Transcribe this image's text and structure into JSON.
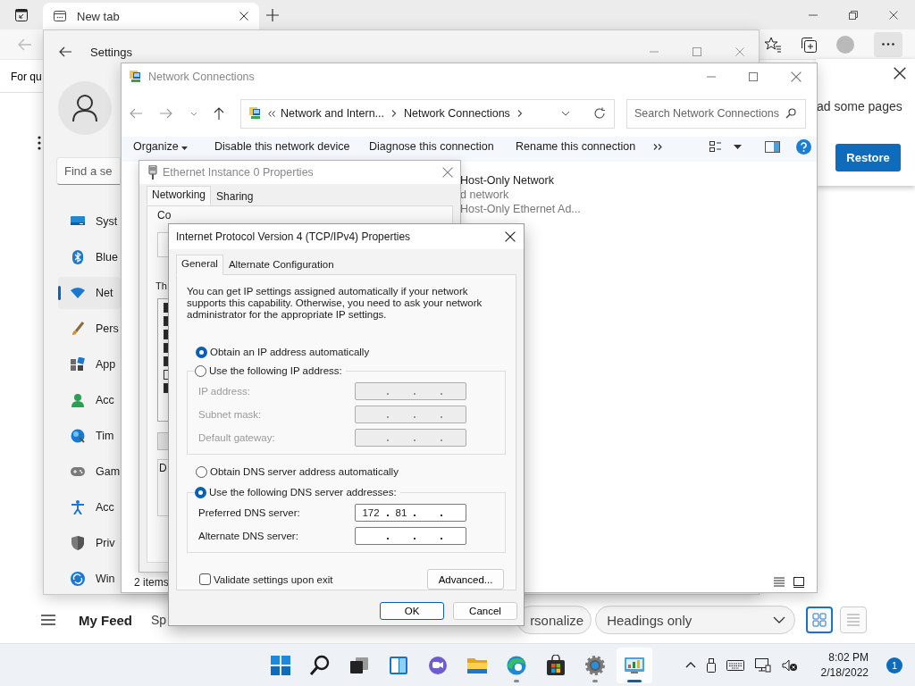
{
  "browser": {
    "tabs": [
      {
        "label": "New tab",
        "selected": true
      }
    ],
    "page_heading": "For qu",
    "restore_banner": {
      "text": "ad some pages",
      "button": "Restore"
    },
    "feed_bar": {
      "tabs": [
        {
          "label": "My Feed",
          "selected": true
        },
        {
          "label": "Sp",
          "selected": false
        }
      ],
      "personalize_button": "rsonalize",
      "view_dropdown": "Headings only",
      "layout_buttons": [
        {
          "selected": true
        },
        {
          "selected": false
        }
      ]
    }
  },
  "settings": {
    "title": "Settings",
    "search": {
      "placeholder": "Find a se"
    },
    "nav": [
      {
        "label": "Syst",
        "selected": false
      },
      {
        "label": "Blue",
        "selected": false
      },
      {
        "label": "Net",
        "selected": true
      },
      {
        "label": "Pers",
        "selected": false
      },
      {
        "label": "App",
        "selected": false
      },
      {
        "label": "Acc",
        "selected": false
      },
      {
        "label": "Tim",
        "selected": false
      },
      {
        "label": "Gam",
        "selected": false
      },
      {
        "label": "Acc",
        "selected": false
      },
      {
        "label": "Priv",
        "selected": false
      },
      {
        "label": "Win",
        "selected": false
      }
    ]
  },
  "network_connections": {
    "title": "Network Connections",
    "breadcrumb": [
      "Network and Intern...",
      "Network Connections"
    ],
    "search": {
      "placeholder": "Search Network Connections"
    },
    "toolbar": [
      "Organize",
      "Disable this network device",
      "Diagnose this connection",
      "Rename this connection"
    ],
    "connection": {
      "name": "Host-Only Network",
      "status": "d network",
      "device": "Host-Only Ethernet Ad..."
    },
    "status_bar": "2 items"
  },
  "ethernet_properties": {
    "title": "Ethernet Instance 0 Properties",
    "tabs": [
      {
        "label": "Networking",
        "selected": true
      },
      {
        "label": "Sharing",
        "selected": false
      }
    ],
    "connect_label": "Co",
    "items_label": "Th",
    "description_label": "D",
    "components": [
      {
        "checked": true
      },
      {
        "checked": true
      },
      {
        "checked": true
      },
      {
        "checked": true
      },
      {
        "checked": true
      },
      {
        "checked": false
      },
      {
        "checked": true
      }
    ]
  },
  "ipv4_properties": {
    "title": "Internet Protocol Version 4 (TCP/IPv4) Properties",
    "tabs": [
      {
        "label": "General",
        "selected": true
      },
      {
        "label": "Alternate Configuration",
        "selected": false
      }
    ],
    "intro": "You can get IP settings assigned automatically if your network supports this capability. Otherwise, you need to ask your network administrator for the appropriate IP settings.",
    "ip_options": [
      {
        "label": "Obtain an IP address automatically",
        "selected": true
      },
      {
        "label": "Use the following IP address:",
        "selected": false
      }
    ],
    "ip_fields": [
      {
        "label": "IP address:",
        "disabled": true
      },
      {
        "label": "Subnet mask:",
        "disabled": true
      },
      {
        "label": "Default gateway:",
        "disabled": true
      }
    ],
    "dns_options": [
      {
        "label": "Obtain DNS server address automatically",
        "selected": false
      },
      {
        "label": "Use the following DNS server addresses:",
        "selected": true
      }
    ],
    "dns_fields": [
      {
        "label": "Preferred DNS server:",
        "octets": [
          "172",
          "81"
        ],
        "disabled": false
      },
      {
        "label": "Alternate DNS server:",
        "disabled": false
      }
    ],
    "validate": {
      "label": "Validate settings upon exit",
      "checked": false
    },
    "advanced_button": "Advanced...",
    "buttons": [
      "OK",
      "Cancel"
    ]
  },
  "taskbar": {
    "apps": [
      {
        "running": false,
        "selected": false
      },
      {
        "running": false,
        "selected": false
      },
      {
        "running": false,
        "selected": false
      },
      {
        "running": false,
        "selected": false
      },
      {
        "running": false,
        "selected": false
      },
      {
        "running": false,
        "selected": false
      },
      {
        "running": true,
        "selected": false
      },
      {
        "running": false,
        "selected": false
      },
      {
        "running": true,
        "selected": false
      },
      {
        "running": true,
        "selected": true
      }
    ],
    "clock": {
      "time": "8:02 PM",
      "date": "2/18/2022"
    },
    "notification_count": "1"
  }
}
